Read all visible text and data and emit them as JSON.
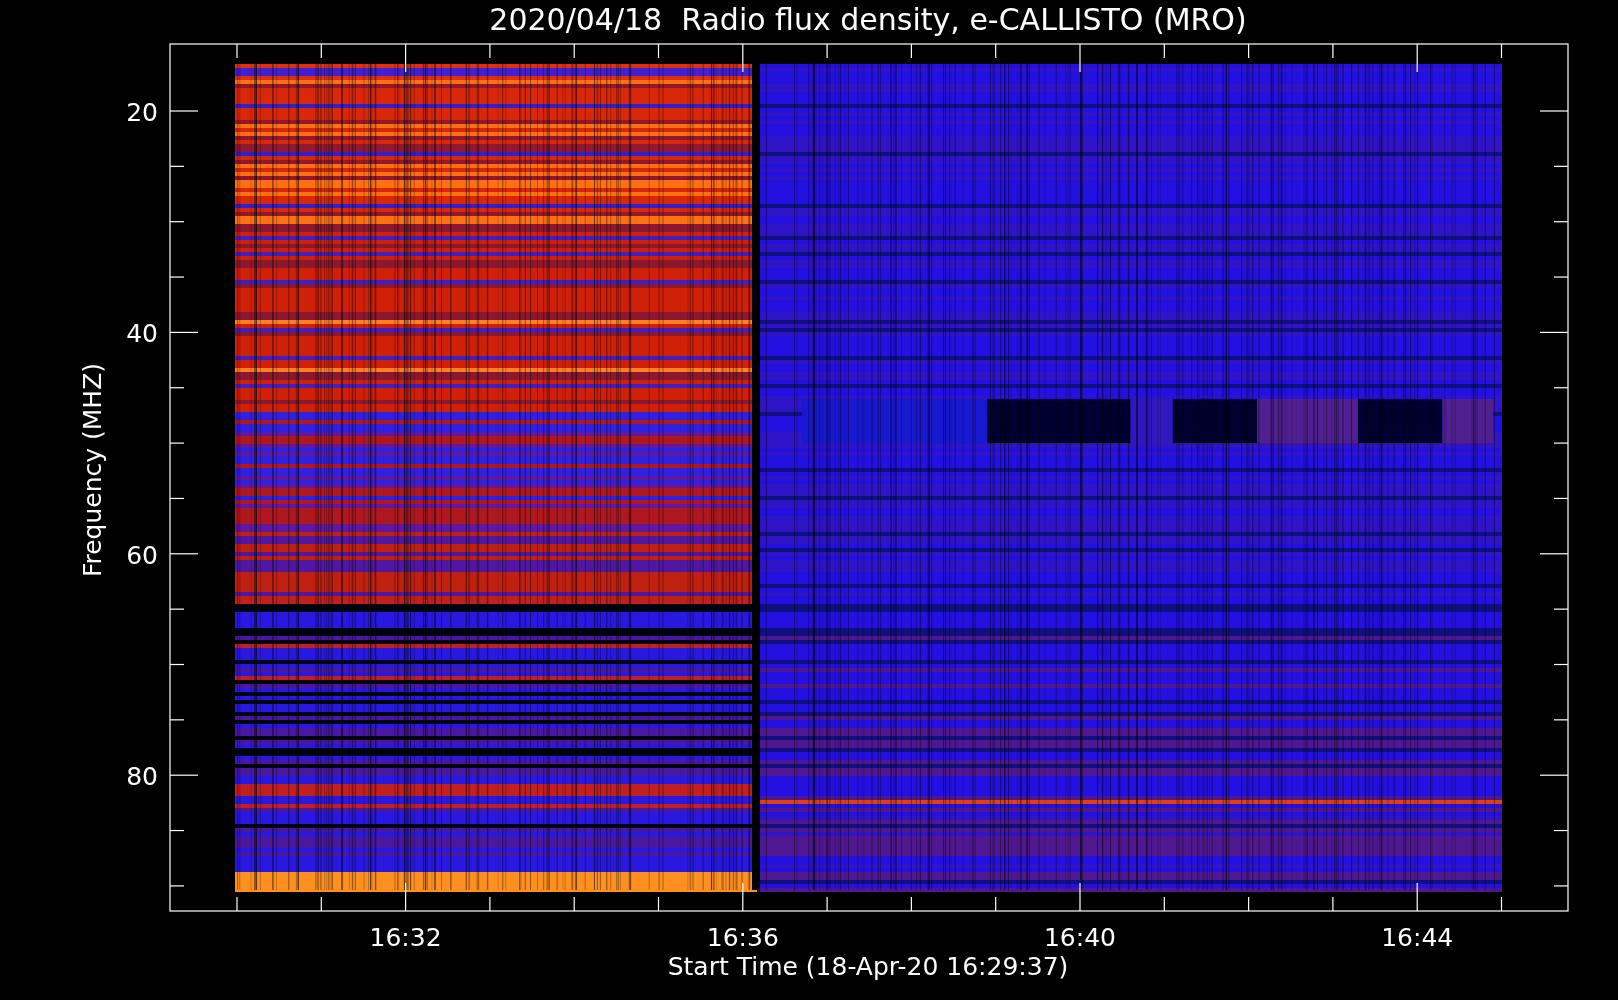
{
  "title": "2020/04/18  Radio flux density, e-CALLISTO (MRO)",
  "y_axis": {
    "label": "Frequency (MHZ)",
    "ticks": [
      "20",
      "40",
      "60",
      "80"
    ]
  },
  "x_axis": {
    "label": "Start Time (18-Apr-20 16:29:37)",
    "ticks": [
      "16:32",
      "16:36",
      "16:40",
      "16:44"
    ]
  }
}
